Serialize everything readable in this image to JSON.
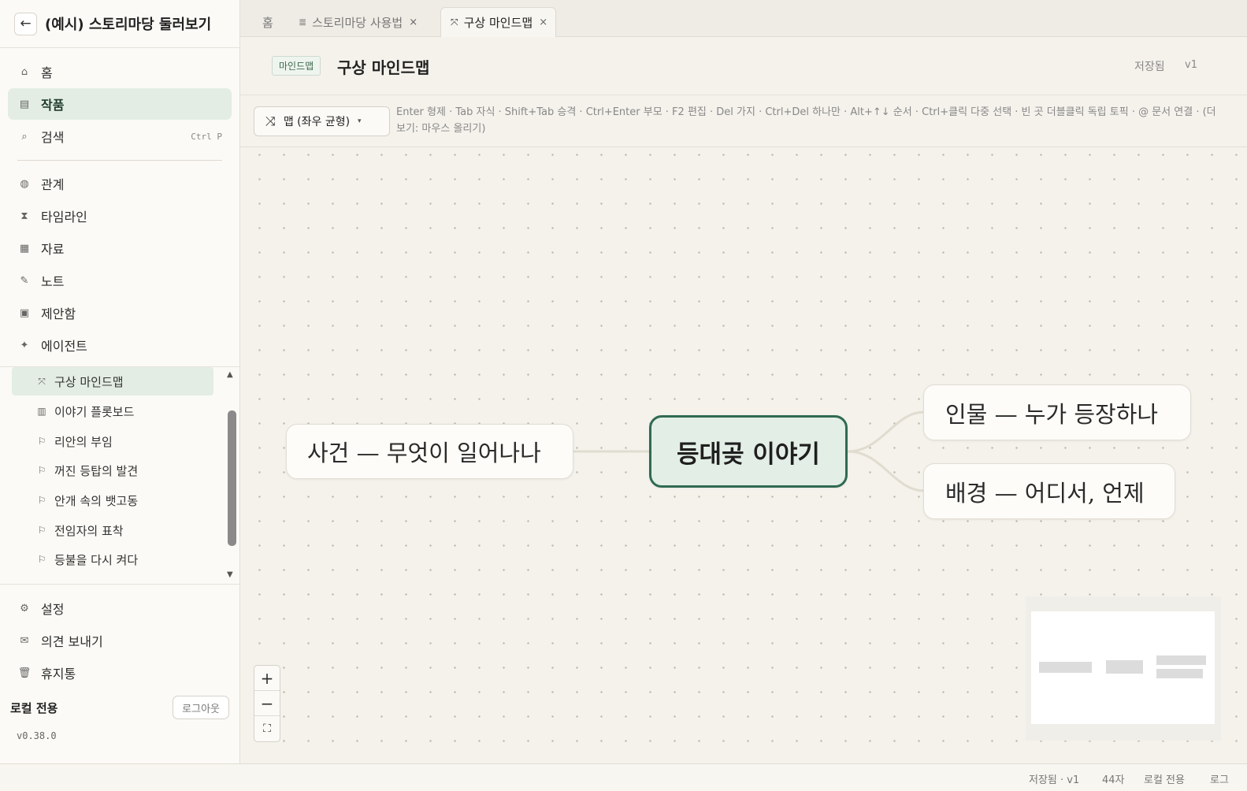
{
  "project": {
    "back_icon": "arrow-left-icon",
    "title": "(예시) 스토리마당 둘러보기"
  },
  "nav": {
    "primary": [
      {
        "icon": "home-icon",
        "glyph": "⌂",
        "label": "홈"
      },
      {
        "icon": "works-icon",
        "glyph": "▤",
        "label": "작품",
        "active": true
      },
      {
        "icon": "search-icon",
        "glyph": "⌕",
        "label": "검색",
        "shortcut": "Ctrl P"
      }
    ],
    "secondary": [
      {
        "icon": "relations-icon",
        "glyph": "◍",
        "label": "관계"
      },
      {
        "icon": "timeline-icon",
        "glyph": "⧗",
        "label": "타임라인"
      },
      {
        "icon": "materials-icon",
        "glyph": "▦",
        "label": "자료"
      },
      {
        "icon": "note-icon",
        "glyph": "✎",
        "label": "노트"
      },
      {
        "icon": "inbox-icon",
        "glyph": "▣",
        "label": "제안함"
      },
      {
        "icon": "agent-icon",
        "glyph": "✦",
        "label": "에이전트"
      }
    ]
  },
  "tree": {
    "items": [
      {
        "icon": "mindmap-icon",
        "glyph": "⤧",
        "label": "구상 마인드맵",
        "active": true
      },
      {
        "icon": "plotboard-icon",
        "glyph": "▥",
        "label": "이야기 플롯보드"
      },
      {
        "icon": "flag-icon",
        "glyph": "⚐",
        "label": "리안의 부임"
      },
      {
        "icon": "flag-icon",
        "glyph": "⚐",
        "label": "꺼진 등탑의 발견"
      },
      {
        "icon": "flag-icon",
        "glyph": "⚐",
        "label": "안개 속의 뱃고동"
      },
      {
        "icon": "flag-icon",
        "glyph": "⚐",
        "label": "전임자의 표착"
      },
      {
        "icon": "flag-icon",
        "glyph": "⚐",
        "label": "등불을 다시 켜다"
      }
    ]
  },
  "bottom_nav": [
    {
      "icon": "settings-icon",
      "glyph": "⚙",
      "label": "설정"
    },
    {
      "icon": "mail-icon",
      "glyph": "✉",
      "label": "의견 보내기"
    },
    {
      "icon": "trash-icon",
      "glyph": "🗑",
      "label": "휴지통"
    }
  ],
  "footer": {
    "local_label": "로컬 전용",
    "logout": "로그아웃",
    "version": "v0.38.0"
  },
  "tabs": [
    {
      "label": "홈"
    },
    {
      "label": "스토리마당 사용법",
      "icon": "document-icon",
      "glyph": "≣",
      "close": "×"
    },
    {
      "label": "구상 마인드맵",
      "icon": "mindmap-icon",
      "glyph": "⤧",
      "close": "×",
      "active": true
    }
  ],
  "doc": {
    "badge": "마인드맵",
    "title": "구상 마인드맵",
    "saved": "저장됨",
    "version": "v1"
  },
  "toolbar": {
    "layout_icon": "layout-balanced-icon",
    "layout_glyph": "⤨",
    "layout_label": "맵 (좌우 균형)",
    "caret": "▾",
    "hint": "Enter 형제 · Tab 자식 · Shift+Tab 승격 · Ctrl+Enter 부모 · F2 편집 · Del 가지 · Ctrl+Del 하나만 · Alt+↑↓ 순서 · Ctrl+클릭 다중 선택 · 빈 곳 더블클릭 독립 토픽 · @ 문서 연결 · (더 보기: 마우스 올리기)"
  },
  "mindmap": {
    "root": "등대곶 이야기",
    "left": [
      "사건 — 무엇이 일어나나"
    ],
    "right": [
      "인물 — 누가 등장하나",
      "배경 — 어디서, 언제"
    ],
    "colors": {
      "root_border": "#2f6b52",
      "root_fill": "#e3eee6",
      "link": "#e0dccf"
    }
  },
  "zoom": {
    "in": "+",
    "out": "−",
    "fit": "⛶"
  },
  "status": {
    "saved": "저장됨 · v1",
    "chars": "44자",
    "mode": "로컬 전용",
    "log": "로그"
  }
}
